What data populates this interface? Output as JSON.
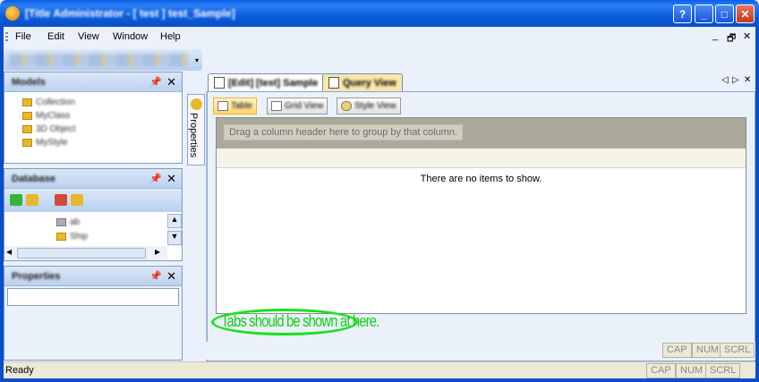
{
  "window": {
    "title": "[Title Administrator - [ test ] test_Sample]",
    "buttons": {
      "help": "?",
      "minimize": "_",
      "maximize": "□",
      "close": "✕"
    }
  },
  "menu": {
    "items": [
      "File",
      "Edit",
      "View",
      "Window",
      "Help"
    ],
    "mdi_minimize": "_",
    "mdi_restore": "🗗",
    "mdi_close": "✕"
  },
  "toolbar": {
    "overflow": "▾"
  },
  "panels": {
    "models": {
      "title": "Models",
      "items": [
        "Collection",
        "MyClass",
        "3D Object",
        "MyStyle"
      ]
    },
    "database": {
      "title": "Database",
      "items": [
        "ab",
        "Ship"
      ]
    },
    "properties": {
      "title": "Properties"
    },
    "pin_glyph": "📌",
    "close_glyph": "✕"
  },
  "side_tab": {
    "label": "Properties"
  },
  "document_tabs": {
    "tabs": [
      {
        "label": "[Edit] [test] Sample",
        "active": true
      },
      {
        "label": "Query View",
        "active": false
      }
    ],
    "nav_left": "◁",
    "nav_right": "▷",
    "close": "✕"
  },
  "view_modes": {
    "buttons": [
      "Table",
      "Grid View",
      "Style View"
    ],
    "active": "Table"
  },
  "grid": {
    "group_hint": "Drag a column header here to group by that column.",
    "empty_message": "There are no items to show."
  },
  "annotation": {
    "text": "Tabs should be shown at here.",
    "color": "#19e019"
  },
  "status_bar": {
    "text": "Ready",
    "inner_indicators": [
      "CAP",
      "NUM",
      "SCRL"
    ],
    "indicators": [
      "CAP",
      "NUM",
      "SCRL"
    ]
  }
}
